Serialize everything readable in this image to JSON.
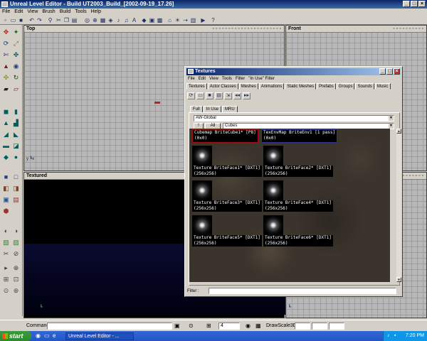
{
  "app": {
    "title": "Unreal Level Editor - Build UT2003_Build_[2002-09-19_17.26]",
    "menu": [
      "File",
      "Edit",
      "View",
      "Brush",
      "Build",
      "Tools",
      "Help"
    ]
  },
  "viewports": {
    "top": {
      "label": "Top"
    },
    "front": {
      "label": "Front"
    },
    "textured": {
      "label": "Textured"
    }
  },
  "statusbar": {
    "command_label": "Command",
    "grid_value": "4",
    "drawscale_label": "DrawScale3D"
  },
  "taskbar": {
    "start_label": "start",
    "task_item": "Unreal Level Editor - ...",
    "clock": "7:20 PM"
  },
  "texture_browser": {
    "title": "Textures",
    "menu": [
      "File",
      "Edit",
      "View",
      "Tools",
      "Filter",
      "\"In Use\" Filter"
    ],
    "tabs": [
      "Textures",
      "Actor Classes",
      "Meshes",
      "Animations",
      "Static Meshes",
      "Prefabs",
      "Groups",
      "Sounds",
      "Music"
    ],
    "subtabs": [
      "Full",
      "In Use",
      "MRU"
    ],
    "package": "AW-Global",
    "group_button_1": "!",
    "group_button_2": "All",
    "group": "Cubes",
    "items": [
      {
        "name": "Cubemap BriteCube1* [P8]",
        "size": "(0x0)"
      },
      {
        "name": "TexEnvMap BriteEnv1 [1 pass]",
        "size": "(0x0)"
      },
      {
        "name": "Texture BriteFace1* [DXT1]",
        "size": "(256x256)"
      },
      {
        "name": "Texture BriteFace2* [DXT1]",
        "size": "(256x256)"
      },
      {
        "name": "Texture BriteFace3* [DXT1]",
        "size": "(256x256)"
      },
      {
        "name": "Texture BriteFace4* [DXT1]",
        "size": "(256x256)"
      },
      {
        "name": "Texture BriteFace5* [DXT1]",
        "size": "(256x256)"
      },
      {
        "name": "Texture BriteFace6* [DXT1]",
        "size": "(256x256)"
      }
    ],
    "filter_label": "Filter :"
  }
}
